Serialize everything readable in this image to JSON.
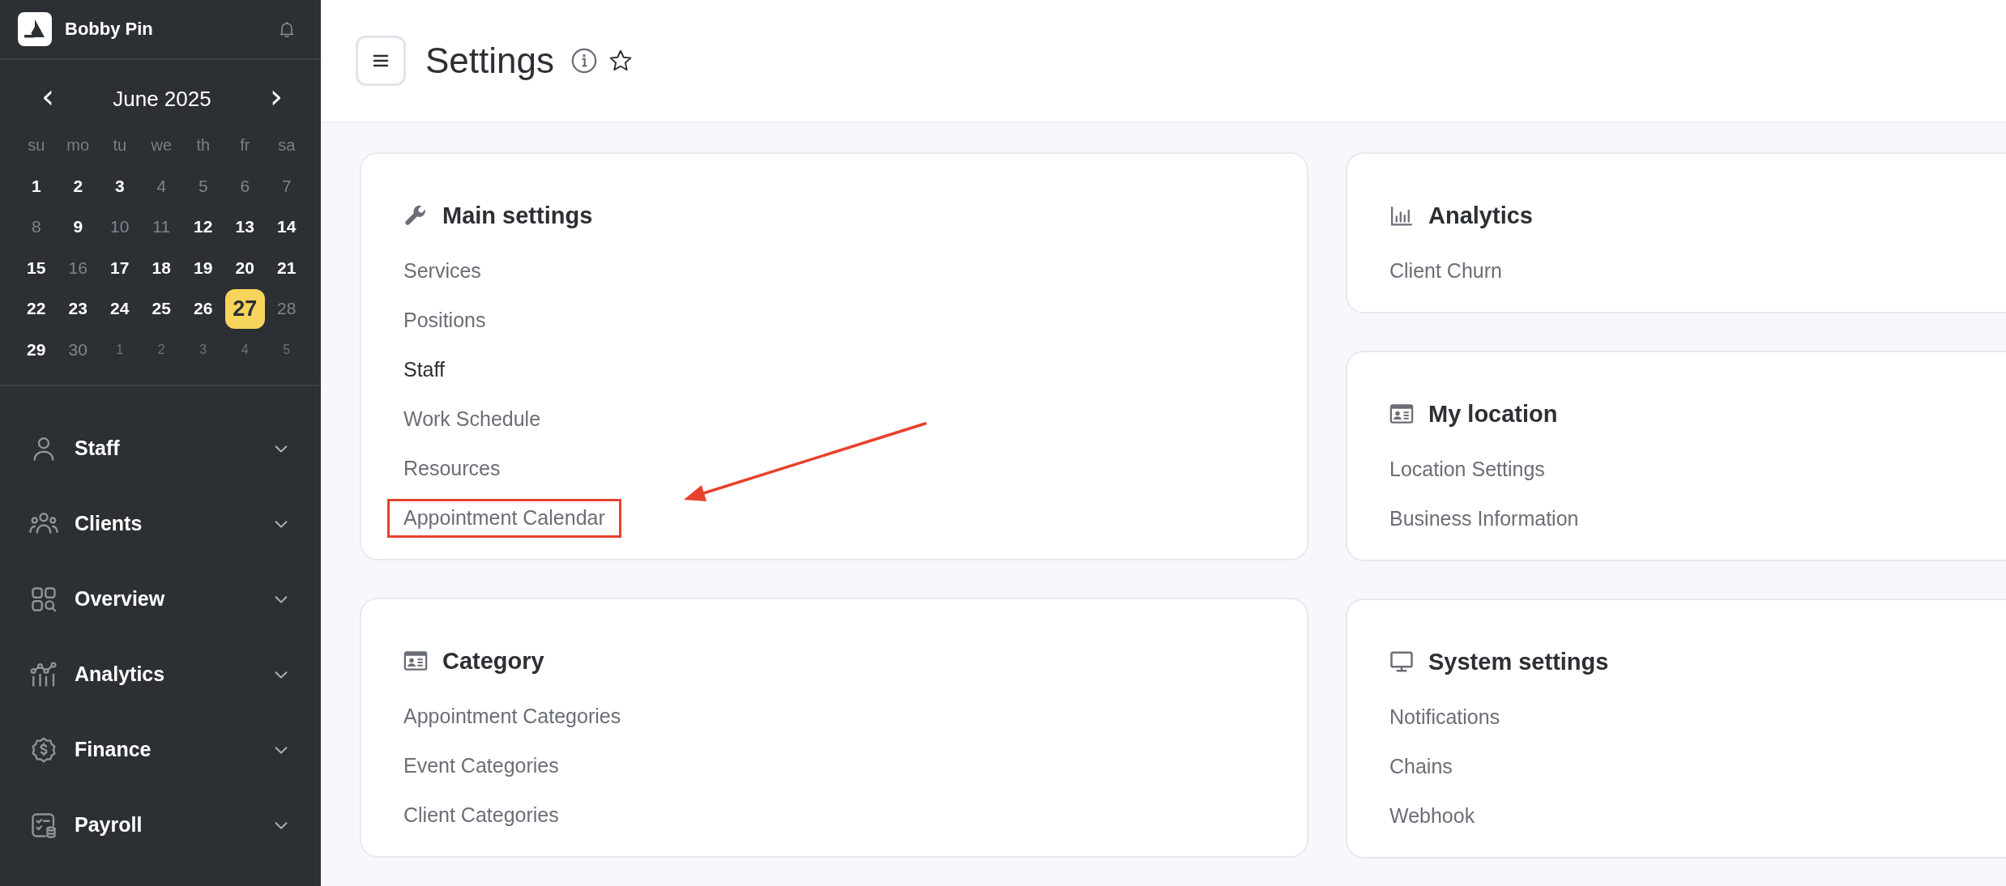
{
  "sidebar": {
    "account": {
      "name": "Bobby Pin"
    },
    "calendar": {
      "month": "June 2025",
      "prev": "‹",
      "next": "›",
      "weekdays": [
        "su",
        "mo",
        "tu",
        "we",
        "th",
        "fr",
        "sa"
      ],
      "days": [
        {
          "label": "1",
          "muted": false,
          "other_month": false,
          "selected": false
        },
        {
          "label": "2",
          "muted": false,
          "other_month": false,
          "selected": false
        },
        {
          "label": "3",
          "muted": false,
          "other_month": false,
          "selected": false
        },
        {
          "label": "4",
          "muted": true,
          "other_month": false,
          "selected": false
        },
        {
          "label": "5",
          "muted": true,
          "other_month": false,
          "selected": false
        },
        {
          "label": "6",
          "muted": true,
          "other_month": false,
          "selected": false
        },
        {
          "label": "7",
          "muted": true,
          "other_month": false,
          "selected": false
        },
        {
          "label": "8",
          "muted": true,
          "other_month": false,
          "selected": false
        },
        {
          "label": "9",
          "muted": false,
          "other_month": false,
          "selected": false
        },
        {
          "label": "10",
          "muted": true,
          "other_month": false,
          "selected": false
        },
        {
          "label": "11",
          "muted": true,
          "other_month": false,
          "selected": false
        },
        {
          "label": "12",
          "muted": false,
          "other_month": false,
          "selected": false
        },
        {
          "label": "13",
          "muted": false,
          "other_month": false,
          "selected": false
        },
        {
          "label": "14",
          "muted": false,
          "other_month": false,
          "selected": false
        },
        {
          "label": "15",
          "muted": false,
          "other_month": false,
          "selected": false
        },
        {
          "label": "16",
          "muted": true,
          "other_month": false,
          "selected": false
        },
        {
          "label": "17",
          "muted": false,
          "other_month": false,
          "selected": false
        },
        {
          "label": "18",
          "muted": false,
          "other_month": false,
          "selected": false
        },
        {
          "label": "19",
          "muted": false,
          "other_month": false,
          "selected": false
        },
        {
          "label": "20",
          "muted": false,
          "other_month": false,
          "selected": false
        },
        {
          "label": "21",
          "muted": false,
          "other_month": false,
          "selected": false
        },
        {
          "label": "22",
          "muted": false,
          "other_month": false,
          "selected": false
        },
        {
          "label": "23",
          "muted": false,
          "other_month": false,
          "selected": false
        },
        {
          "label": "24",
          "muted": false,
          "other_month": false,
          "selected": false
        },
        {
          "label": "25",
          "muted": false,
          "other_month": false,
          "selected": false
        },
        {
          "label": "26",
          "muted": false,
          "other_month": false,
          "selected": false
        },
        {
          "label": "27",
          "muted": false,
          "other_month": false,
          "selected": true
        },
        {
          "label": "28",
          "muted": true,
          "other_month": false,
          "selected": false
        },
        {
          "label": "29",
          "muted": false,
          "other_month": false,
          "selected": false
        },
        {
          "label": "30",
          "muted": true,
          "other_month": false,
          "selected": false
        },
        {
          "label": "1",
          "muted": true,
          "other_month": true,
          "selected": false
        },
        {
          "label": "2",
          "muted": true,
          "other_month": true,
          "selected": false
        },
        {
          "label": "3",
          "muted": true,
          "other_month": true,
          "selected": false
        },
        {
          "label": "4",
          "muted": true,
          "other_month": true,
          "selected": false
        },
        {
          "label": "5",
          "muted": true,
          "other_month": true,
          "selected": false
        }
      ]
    },
    "nav": [
      {
        "label": "Staff",
        "kind": "person",
        "expanded": false
      },
      {
        "label": "Clients",
        "kind": "people",
        "expanded": false
      },
      {
        "label": "Overview",
        "kind": "overview",
        "expanded": false
      },
      {
        "label": "Analytics",
        "kind": "analytics",
        "expanded": false
      },
      {
        "label": "Finance",
        "kind": "finance",
        "expanded": false
      },
      {
        "label": "Payroll",
        "kind": "payroll",
        "expanded": false
      }
    ]
  },
  "header": {
    "title": "Settings"
  },
  "columns": [
    {
      "sections": [
        {
          "title": "Main settings",
          "kind": "main",
          "items": [
            {
              "label": "Services",
              "active": false,
              "highlighted": false
            },
            {
              "label": "Positions",
              "active": false,
              "highlighted": false
            },
            {
              "label": "Staff",
              "active": true,
              "highlighted": false
            },
            {
              "label": "Work Schedule",
              "active": false,
              "highlighted": false
            },
            {
              "label": "Resources",
              "active": false,
              "highlighted": false
            },
            {
              "label": "Appointment Calendar",
              "active": false,
              "highlighted": true
            }
          ]
        },
        {
          "title": "Category",
          "kind": "category",
          "items": [
            {
              "label": "Appointment Categories",
              "active": false,
              "highlighted": false
            },
            {
              "label": "Event Categories",
              "active": false,
              "highlighted": false
            },
            {
              "label": "Client Categories",
              "active": false,
              "highlighted": false
            }
          ]
        }
      ]
    },
    {
      "sections": [
        {
          "title": "Analytics",
          "kind": "analytics",
          "items": [
            {
              "label": "Client Churn",
              "active": false,
              "highlighted": false
            }
          ]
        },
        {
          "title": "My location",
          "kind": "location",
          "items": [
            {
              "label": "Location Settings",
              "active": false,
              "highlighted": false
            },
            {
              "label": "Business Information",
              "active": false,
              "highlighted": false
            }
          ]
        },
        {
          "title": "System settings",
          "kind": "system",
          "items": [
            {
              "label": "Notifications",
              "active": false,
              "highlighted": false
            },
            {
              "label": "Chains",
              "active": false,
              "highlighted": false
            },
            {
              "label": "Webhook",
              "active": false,
              "highlighted": false
            }
          ]
        }
      ]
    }
  ]
}
